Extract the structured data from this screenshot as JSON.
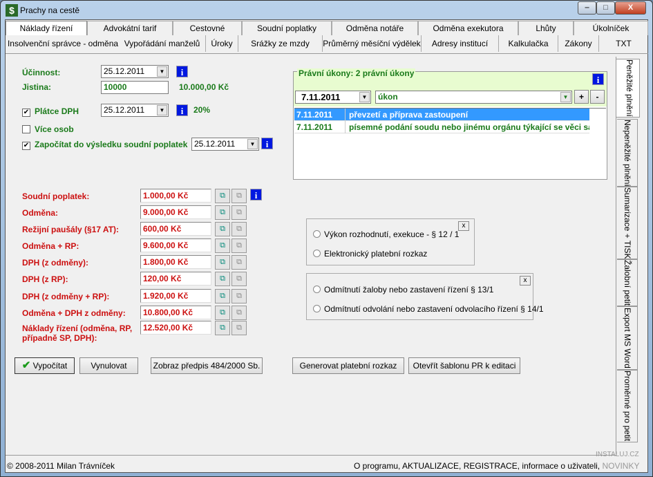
{
  "window": {
    "title": "Prachy na cestě",
    "minimize": "‒",
    "maximize": "□",
    "close": "X"
  },
  "tabs_row1": [
    "Náklady řízení",
    "Advokátní tarif",
    "Cestovné",
    "Soudní poplatky",
    "Odměna notáře",
    "Odměna exekutora",
    "Lhůty",
    "Úkolníček"
  ],
  "tabs_row2": [
    "Insolvenční správce - odměna",
    "Vypořádání manželů",
    "Úroky",
    "Srážky ze mzdy",
    "Průměrný měsíční výdělek",
    "Adresy institucí",
    "Kalkulačka",
    "Zákony",
    "TXT"
  ],
  "side_tabs": [
    "Peněžité plnění",
    "Nepeněžité plnění",
    "Sumarizace + TISK",
    "Žalobní petit",
    "Export MS Word",
    "Proměnné pro petit"
  ],
  "form": {
    "ucinnost_label": "Účinnost:",
    "ucinnost_date": "25.12.2011",
    "jistina_label": "Jistina:",
    "jistina_value": "10000",
    "jistina_formatted": "10.000,00 Kč",
    "platce_dph_label": "Plátce DPH",
    "platce_dph_checked": true,
    "platce_dph_date": "25.12.2011",
    "dph_rate": "20%",
    "vice_osob_label": "Více osob",
    "vice_osob_checked": false,
    "zapocitat_label": "Započítat do výsledku soudní poplatek",
    "zapocitat_checked": true,
    "zapocitat_date": "25.12.2011",
    "info_glyph": "i"
  },
  "results": [
    {
      "label": "Soudní poplatek:",
      "value": "1.000,00 Kč"
    },
    {
      "label": "Odměna:",
      "value": "9.000,00 Kč"
    },
    {
      "label": "Režijní paušály (§17 AT):",
      "value": "600,00 Kč"
    },
    {
      "label": "Odměna + RP:",
      "value": "9.600,00 Kč"
    },
    {
      "label": "DPH (z odměny):",
      "value": "1.800,00 Kč"
    },
    {
      "label": "DPH (z RP):",
      "value": "120,00 Kč"
    },
    {
      "label": "DPH (z odměny + RP):",
      "value": "1.920,00 Kč"
    },
    {
      "label": "Odměna + DPH z odměny:",
      "value": "10.800,00 Kč"
    },
    {
      "label": "Náklady řízení (odměna, RP, případně SP, DPH):",
      "value": "12.520,00 Kč"
    }
  ],
  "ukony": {
    "legend": "Právní úkony: 2 právní úkony",
    "date": "7.11.2011",
    "ukon": "úkon",
    "add": "+",
    "remove": "-",
    "rows": [
      {
        "date": "7.11.2011",
        "text": "převzetí a příprava zastoupení",
        "selected": true
      },
      {
        "date": "7.11.2011",
        "text": "písemné podání soudu nebo jinému orgánu týkající se věci sa",
        "selected": false
      }
    ]
  },
  "options1": {
    "close": "x",
    "items": [
      "Výkon rozhodnutí, exekuce - § 12 / 1",
      "Elektronický platební rozkaz"
    ]
  },
  "options2": {
    "close": "x",
    "items": [
      "Odmítnutí žaloby nebo zastavení řízení § 13/1",
      "Odmítnutí odvolání nebo zastavení odvolacího řízení § 14/1"
    ]
  },
  "buttons": {
    "vypocitat": "Vypočítat",
    "vynulovat": "Vynulovat",
    "zobraz": "Zobraz předpis 484/2000 Sb.",
    "generovat": "Generovat platební rozkaz",
    "otevrit": "Otevřít šablonu PR k editaci"
  },
  "status": {
    "copyright": "© 2008-2011 Milan Trávníček",
    "links": "O programu, AKTUALIZACE, REGISTRACE, informace o uživateli,",
    "novinky": "NOVINKY"
  },
  "watermark": "INSTALUJ.CZ",
  "colors": {
    "green": "#1a7a1a",
    "red": "#cc1010",
    "selection": "#3399ff",
    "group_bg": "#e8fcd0"
  }
}
